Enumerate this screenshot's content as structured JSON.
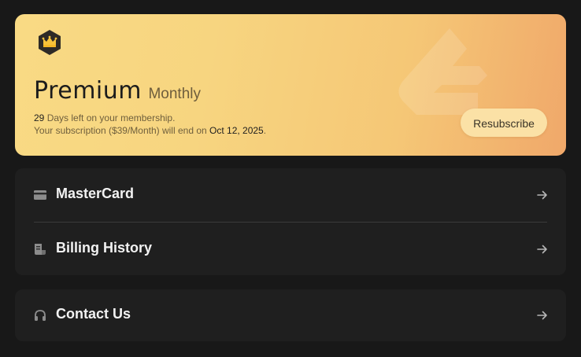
{
  "premium": {
    "plan_name": "Premium",
    "plan_period": "Monthly",
    "days_left": "29",
    "days_suffix": " Days left on your membership.",
    "end_prefix": "Your subscription ($39/Month) will end on ",
    "end_date": "Oct 12, 2025",
    "end_suffix": ".",
    "resubscribe_label": "Resubscribe"
  },
  "billing": {
    "items": [
      {
        "label": "MasterCard",
        "icon": "credit-card-icon"
      },
      {
        "label": "Billing History",
        "icon": "receipt-icon"
      }
    ]
  },
  "support": {
    "items": [
      {
        "label": "Contact Us",
        "icon": "headphones-icon"
      }
    ]
  },
  "colors": {
    "page_background": "#181818",
    "panel_background": "#1f1f1f",
    "premium_gradient_start": "#f9da84",
    "premium_gradient_end": "#f0a86a",
    "crown_gold": "#f5b726"
  }
}
